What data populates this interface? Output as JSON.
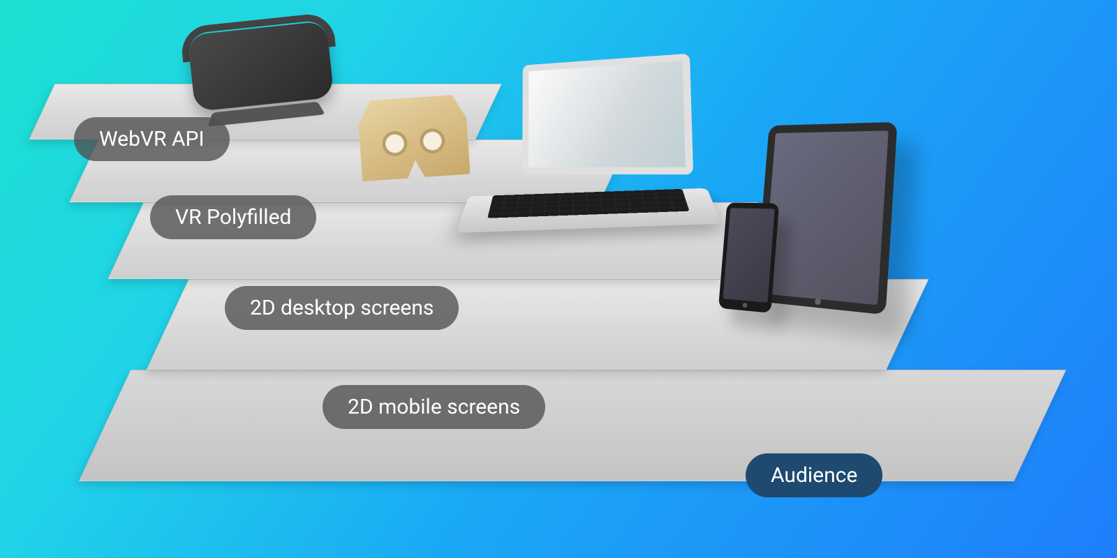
{
  "tiers": [
    {
      "label": "WebVR API"
    },
    {
      "label": "VR Polyfilled"
    },
    {
      "label": "2D desktop screens"
    },
    {
      "label": "2D mobile screens"
    }
  ],
  "audience_label": "Audience",
  "colors": {
    "pill_bg": "rgba(80,80,80,0.78)",
    "audience_bg": "#1e4a6f"
  }
}
